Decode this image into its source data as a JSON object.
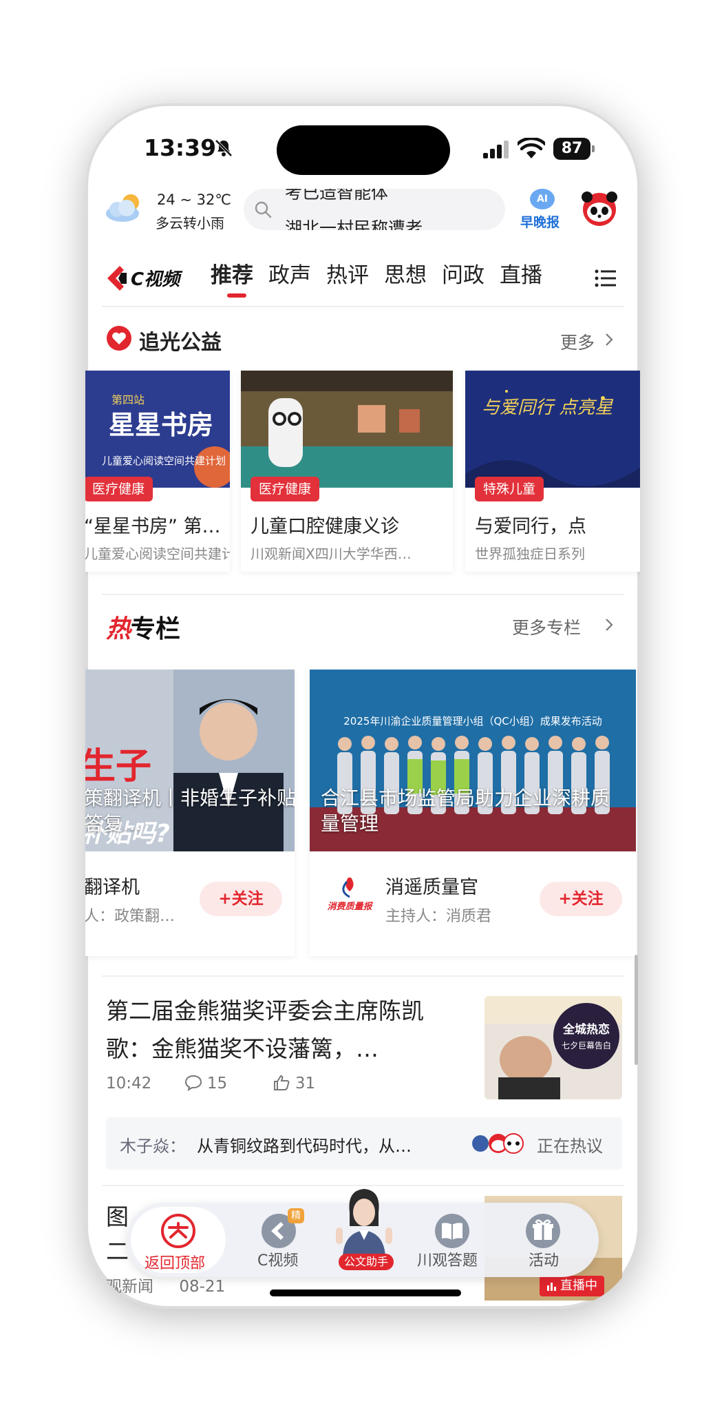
{
  "status": {
    "time": "13:39",
    "battery": "87"
  },
  "weather": {
    "temp": "24 ~ 32℃",
    "cond": "多云转小雨"
  },
  "search": {
    "line1": "考已造智能体",
    "line2": "湖北一村民称遭老"
  },
  "header": {
    "ai_label": "早晚报"
  },
  "tabs": [
    "推荐",
    "政声",
    "热评",
    "思想",
    "问政",
    "直播"
  ],
  "section1": {
    "title": "追光公益",
    "more": "更多",
    "cards": [
      {
        "tag": "医疗健康",
        "title": "“星星书房” 第…",
        "sub": "儿童爱心阅读空间共建计划",
        "img_text": "星星书房",
        "img_kicker": "第四站",
        "img_sub": "儿童爱心阅读空间共建计划"
      },
      {
        "tag": "医疗健康",
        "title": "儿童口腔健康义诊",
        "sub": "川观新闻X四川大学华西…"
      },
      {
        "tag": "特殊儿童",
        "title": "与爱同行，点",
        "sub": "世界孤独症日系列",
        "img_text": "与爱同行 点亮星"
      }
    ]
  },
  "section2": {
    "title_hot": "热",
    "title_rest": "专栏",
    "more": "更多专栏",
    "columns": [
      {
        "caption": "策翻译机丨非婚生子补贴吗？权威答复…",
        "name": "翻译机",
        "host": "人：政策翻…",
        "follow": "+关注",
        "img_text": "生子",
        "img_text2": "补贴吗?"
      },
      {
        "caption": "合江县市场监管局助力企业深耕质量管理",
        "name": "消遥质量官",
        "host": "主持人：消质君",
        "follow": "+关注",
        "banner": "2025年川渝企业质量管理小组（QC小组）成果发布活动",
        "logo_text": "消费质量报"
      }
    ]
  },
  "news1": {
    "title": "第二届金熊猫奖评委会主席陈凯歌：金熊猫奖不设藩篱，…",
    "time": "10:42",
    "comments": "15",
    "likes": "31",
    "thumb_text1": "全城热恋",
    "thumb_text2": "七夕巨幕告白"
  },
  "hot_discuss": {
    "user": "木子焱：",
    "text": "从青铜纹路到代码时代，从…",
    "status": "正在热议"
  },
  "news2": {
    "title1": "图",
    "title2": "二",
    "source": "观新闻",
    "date": "08-21",
    "live": "直播中"
  },
  "bottom_nav": {
    "back_top": "返回顶部",
    "cvideo": "C视频",
    "cvideo_badge": "精",
    "assistant": "公文助手",
    "quiz": "川观答题",
    "activity": "活动"
  },
  "colors": {
    "accent": "#e2262e",
    "blue": "#1f6fd8"
  }
}
